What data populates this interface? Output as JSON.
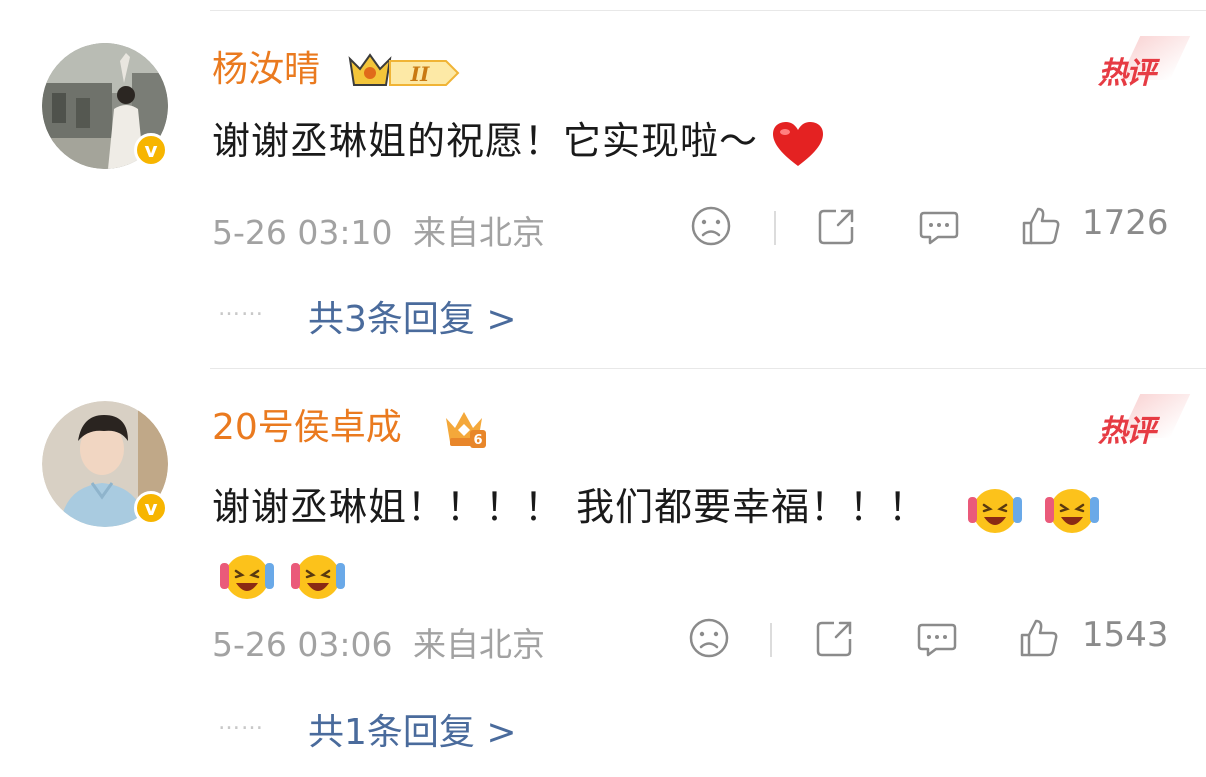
{
  "comments": [
    {
      "name": "杨汝晴",
      "level_badge": "II",
      "hot_label": "热评",
      "text": "谢谢丞琳姐的祝愿！它实现啦～",
      "emoji_end": "heart",
      "date": "5-26 03:10",
      "location": "来自北京",
      "likes": "1726",
      "replies": "共3条回复 >",
      "dots": "……"
    },
    {
      "name": "20号侯卓成",
      "level_badge": "6",
      "hot_label": "热评",
      "text": "谢谢丞琳姐！！！！ 我们都要幸福！！！",
      "emoji_end": "laughing-tears x4",
      "date": "5-26 03:06",
      "location": "来自北京",
      "likes": "1543",
      "replies": "共1条回复 >",
      "dots": "……"
    }
  ],
  "icons": {
    "dislike": "dislike-face-icon",
    "share": "share-icon",
    "comment": "comment-icon",
    "like": "thumbs-up-icon"
  },
  "colors": {
    "name": "#ea7a1f",
    "hot": "#e63b43",
    "reply": "#4a6b9c",
    "meta": "#a2a2a2",
    "verified": "#f7b500"
  }
}
